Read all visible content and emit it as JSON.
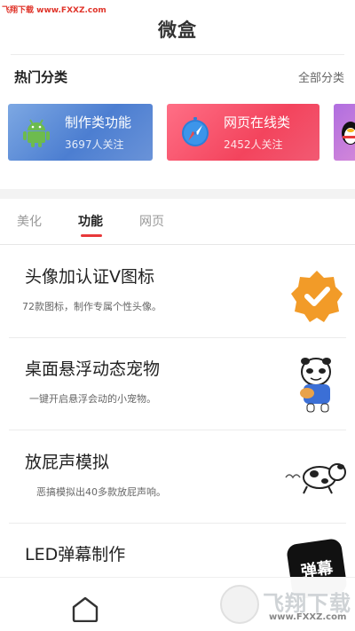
{
  "watermark": {
    "site_top": "飞翔下载 www.FXXZ.com",
    "logo_text": "飞翔下载",
    "logo_url": "www.FXXZ.com"
  },
  "app": {
    "title": "微盒"
  },
  "hot_categories": {
    "title": "热门分类",
    "all_link": "全部分类",
    "cards": [
      {
        "title": "制作类功能",
        "followers": "3697人关注",
        "icon": "android-robot-icon",
        "color": "#4c7ed1"
      },
      {
        "title": "网页在线类",
        "followers": "2452人关注",
        "icon": "compass-icon",
        "color": "#f3445d"
      },
      {
        "icon": "qq-penguin-icon",
        "color": "#b06ee0"
      }
    ]
  },
  "tabs": [
    {
      "label": "美化",
      "active": false
    },
    {
      "label": "功能",
      "active": true
    },
    {
      "label": "网页",
      "active": false
    }
  ],
  "features": [
    {
      "title": "头像加认证V图标",
      "desc": "72款图标，制作专属个性头像。",
      "image": "verified-badge-icon",
      "badge_color": "#f29b28"
    },
    {
      "title": "桌面悬浮动态宠物",
      "desc": "一键开启悬浮会动的小宠物。",
      "image": "panda-sticker-icon"
    },
    {
      "title": "放屁声模拟",
      "desc": "恶搞模拟出40多款放屁声响。",
      "image": "cartoon-dog-icon"
    },
    {
      "title": "LED弹幕制作",
      "desc": "",
      "image_text": "弹幕"
    }
  ],
  "nav": {
    "icon": "home-icon"
  },
  "accent_color": "#e8383a"
}
